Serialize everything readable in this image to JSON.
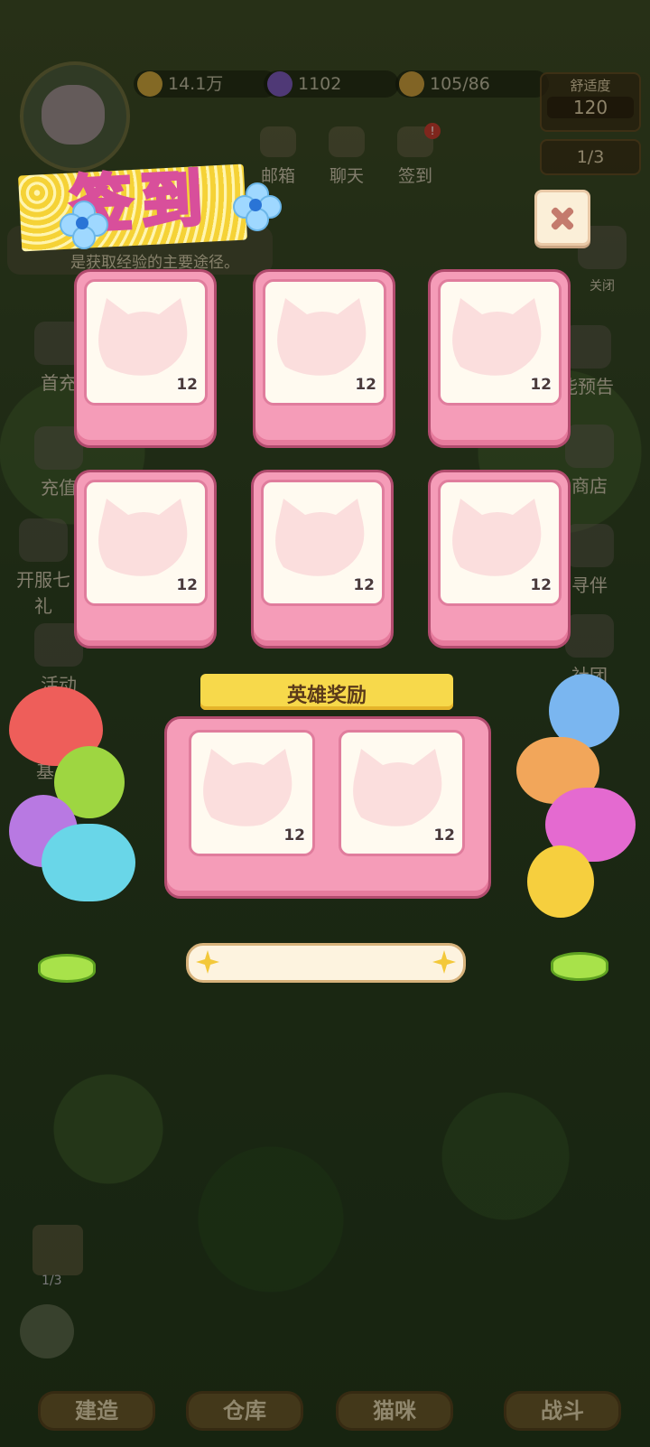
{
  "topbar": {
    "coins": "14.1万",
    "gems": "1102",
    "food": "105/86",
    "comfort_label": "舒适度",
    "comfort_value": "120",
    "ratio": "1/3"
  },
  "top_nav": [
    "邮箱",
    "聊天",
    "签到"
  ],
  "tip_text": "是获取经验的主要途径。",
  "left_side": [
    "首充",
    "充值",
    "开服七",
    "礼",
    "活动",
    "基"
  ],
  "right_side": [
    "关闭",
    "能预告",
    "商店",
    "寻伴",
    "社团"
  ],
  "dialog": {
    "title": "签到",
    "cards": [
      {
        "count": "12"
      },
      {
        "count": "12"
      },
      {
        "count": "12"
      },
      {
        "count": "12"
      },
      {
        "count": "12"
      },
      {
        "count": "12"
      }
    ],
    "hero_label": "英雄奖励",
    "hero_cards": [
      {
        "count": "12"
      },
      {
        "count": "12"
      }
    ]
  },
  "bottom_bar": [
    "建造",
    "仓库",
    "猫咪",
    "战斗"
  ],
  "mini_counter": "1/3",
  "colors": {
    "card_pink": "#f59cb8",
    "card_border": "#b24b6e",
    "ribbon_yellow": "#f7d94b",
    "title_pink": "#d84f9b"
  }
}
